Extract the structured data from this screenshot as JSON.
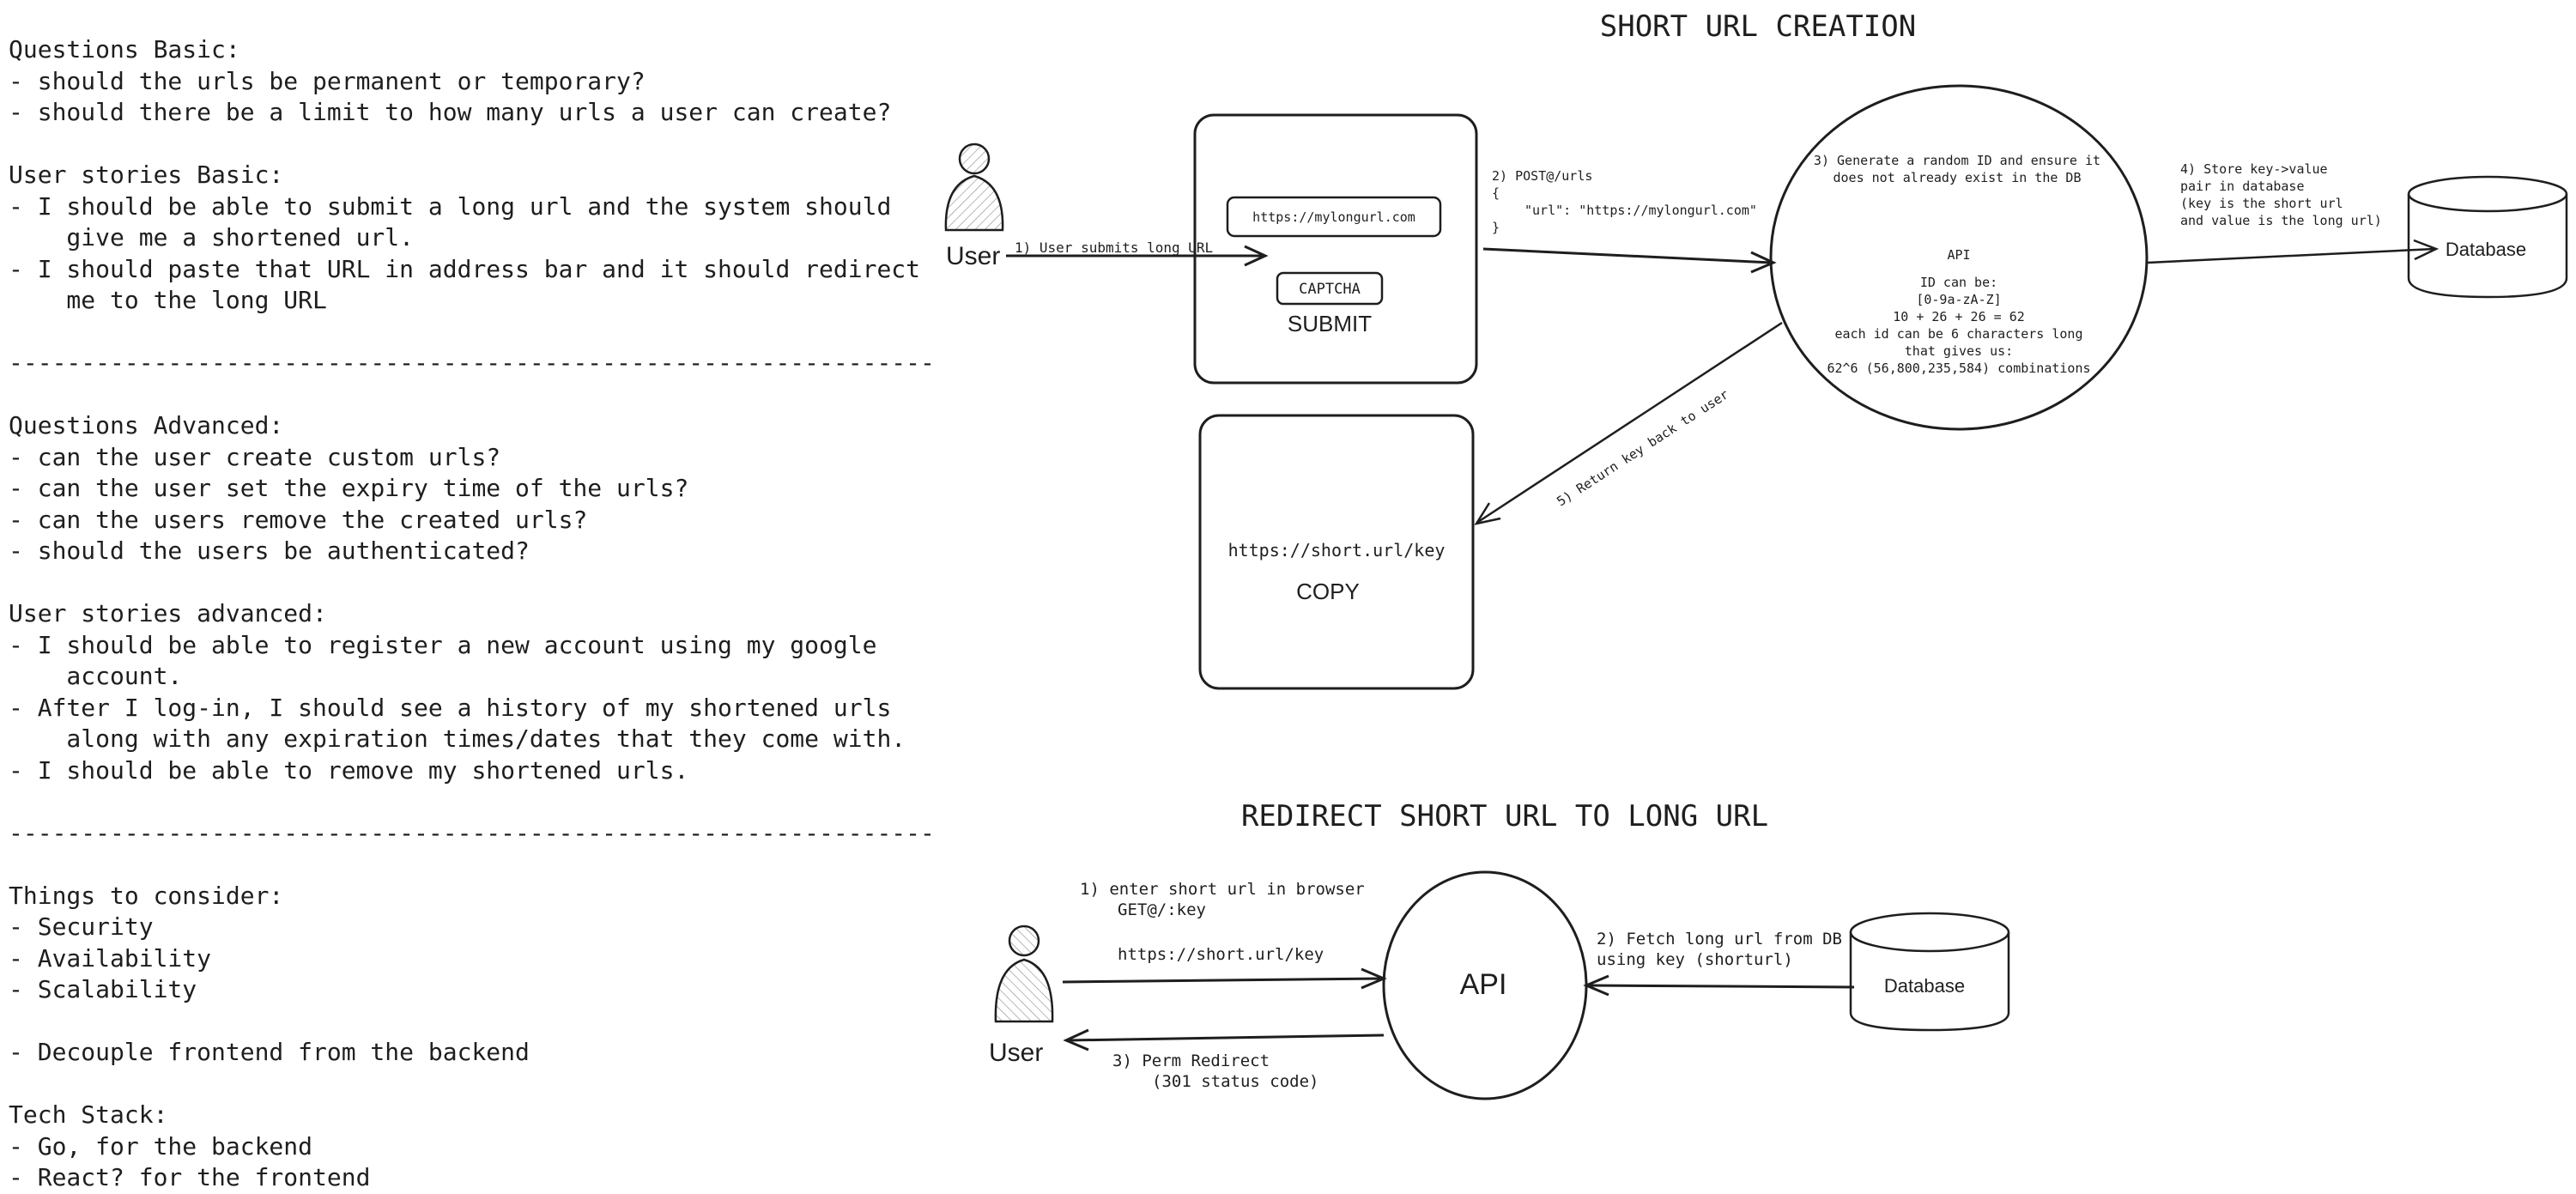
{
  "notes": [
    "Questions Basic:",
    "- should the urls be permanent or temporary?",
    "- should there be a limit to how many urls a user can create?",
    "",
    "User stories Basic:",
    "- I should be able to submit a long url and the system should",
    "    give me a shortened url.",
    "- I should paste that URL in address bar and it should redirect",
    "    me to the long URL",
    "",
    "----------------------------------------------------------------",
    "",
    "Questions Advanced:",
    "- can the user create custom urls?",
    "- can the user set the expiry time of the urls?",
    "- can the users remove the created urls?",
    "- should the users be authenticated?",
    "",
    "User stories advanced:",
    "- I should be able to register a new account using my google",
    "    account.",
    "- After I log-in, I should see a history of my shortened urls",
    "    along with any expiration times/dates that they come with.",
    "- I should be able to remove my shortened urls.",
    "",
    "----------------------------------------------------------------",
    "",
    "Things to consider:",
    "- Security",
    "- Availability",
    "- Scalability",
    "",
    "- Decouple frontend from the backend",
    "",
    "Tech Stack:",
    "- Go, for the backend",
    "- React? for the frontend"
  ],
  "creation": {
    "title": "SHORT URL CREATION",
    "user_label": "User",
    "step1": "1) User submits long URL",
    "form": {
      "input_value": "https://mylongurl.com",
      "captcha": "CAPTCHA",
      "submit": "SUBMIT"
    },
    "step2": {
      "line1": "2) POST@/urls",
      "line2": "{",
      "line3": "\"url\": \"https://mylongurl.com\"",
      "line4": "}"
    },
    "api": {
      "step3_line1": "3) Generate a random ID and ensure it",
      "step3_line2": "does not already exist in the DB",
      "label": "API",
      "info": [
        "ID can be:",
        "[0-9a-zA-Z]",
        "10 + 26 + 26 = 62",
        "each id can be 6 characters long",
        "that gives us:",
        "62^6 (56,800,235,584) combinations"
      ]
    },
    "step4": [
      "4) Store key->value",
      "pair in database",
      "(key is the short url",
      "and value is the long url)"
    ],
    "database": "Database",
    "step5": "5) Return key back to user",
    "result": {
      "url": "https://short.url/key",
      "copy": "COPY"
    }
  },
  "redirect": {
    "title": "REDIRECT SHORT URL TO LONG URL",
    "user_label": "User",
    "step1_line1": "1) enter short url in browser",
    "step1_line2": "GET@/:key",
    "step1_url": "https://short.url/key",
    "api": "API",
    "step2_line1": "2) Fetch long url from DB",
    "step2_line2": "using key (shorturl)",
    "database": "Database",
    "step3_line1": "3) Perm Redirect",
    "step3_line2": "(301 status code)"
  }
}
